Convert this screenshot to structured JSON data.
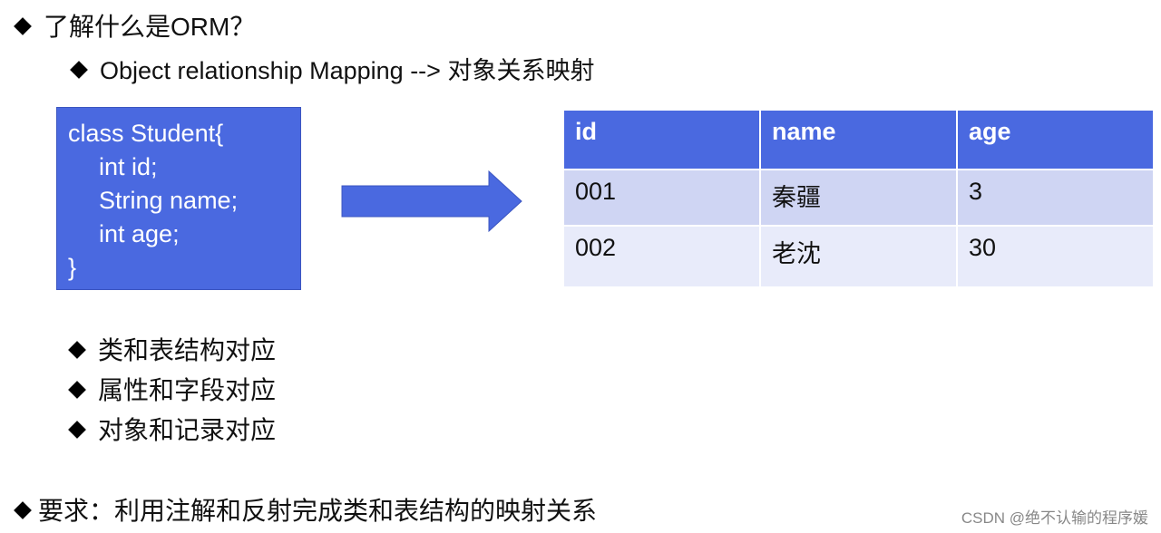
{
  "heading": {
    "title": "了解什么是ORM？",
    "subtitle": "Object relationship Mapping --> 对象关系映射"
  },
  "code": {
    "lines": [
      "class Student{",
      "int id;",
      "String name;",
      "int age;",
      "}"
    ]
  },
  "arrow": {
    "icon": "right-arrow-icon",
    "color": "#4a69e0"
  },
  "table": {
    "headers": [
      "id",
      "name",
      "age"
    ],
    "rows": [
      [
        "001",
        "秦疆",
        "3"
      ],
      [
        "002",
        "老沈",
        "30"
      ]
    ]
  },
  "mappings": [
    "类和表结构对应",
    "属性和字段对应",
    "对象和记录对应"
  ],
  "requirement": "要求：利用注解和反射完成类和表结构的映射关系",
  "watermark": "CSDN @绝不认输的程序媛",
  "colors": {
    "accent": "#4a69e0",
    "row_odd": "#cfd5f3",
    "row_even": "#e8ebfa"
  }
}
